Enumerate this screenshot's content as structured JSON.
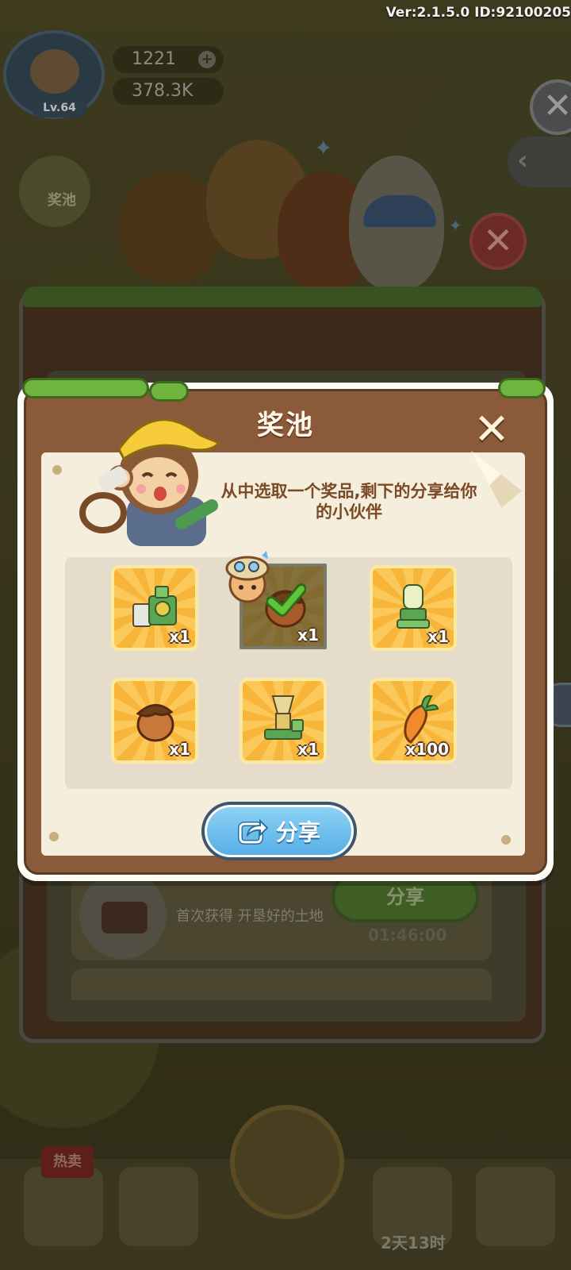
{
  "version_info": "Ver:2.1.5.0 ID:92100205",
  "player": {
    "level": "Lv.64",
    "hearts": "1221",
    "coins": "378.3K"
  },
  "side": {
    "pool_label": "奖池"
  },
  "dialog": {
    "title": "奖池",
    "instruction": "从中选取一个奖品,剩下的分享给你的小伙伴",
    "share_button": "分享",
    "rewards": [
      {
        "icon": "machine-icon",
        "quantity": "x1",
        "selected": false
      },
      {
        "icon": "acorn-icon",
        "quantity": "x1",
        "selected": true
      },
      {
        "icon": "juicer-icon",
        "quantity": "x1",
        "selected": false
      },
      {
        "icon": "hazelnut-icon",
        "quantity": "x1",
        "selected": false
      },
      {
        "icon": "grinder-icon",
        "quantity": "x1",
        "selected": false
      },
      {
        "icon": "carrot-icon",
        "quantity": "x100",
        "selected": false
      }
    ]
  },
  "background_task": {
    "description": "首次获得 开垦好的土地",
    "button": "分享",
    "timer": "01:46:00"
  },
  "bottom_nav": {
    "hot_badge": "热卖",
    "timer": "2天13时"
  },
  "colors": {
    "wood": "#8a5a3a",
    "paper": "#f5eedc",
    "tile": "#f7b53a",
    "share_blue": "#58aee6"
  }
}
